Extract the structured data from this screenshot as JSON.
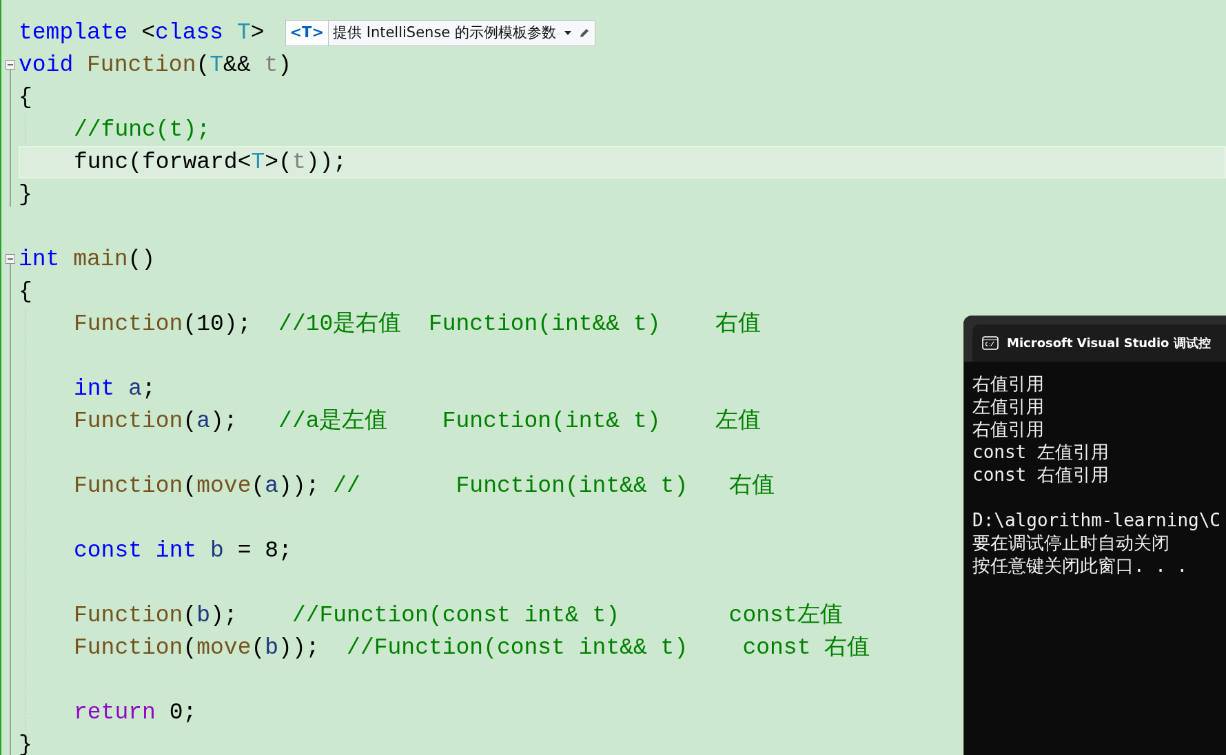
{
  "editor": {
    "template_line": {
      "tokens": [
        {
          "t": "template",
          "kind": "kw"
        },
        {
          "t": " <",
          "kind": "pl"
        },
        {
          "t": "class",
          "kind": "kw"
        },
        {
          "t": " T",
          "kind": "tp"
        },
        {
          "t": ">",
          "kind": "pl"
        }
      ],
      "hint": {
        "badge": "<T>",
        "text": "提供 IntelliSense 的示例模板参数"
      }
    },
    "functions": [
      {
        "collapsible": true,
        "signature": [
          {
            "t": "void",
            "kind": "kw"
          },
          {
            "t": " Function",
            "kind": "fn"
          },
          {
            "t": "(",
            "kind": "pl"
          },
          {
            "t": "T",
            "kind": "tp"
          },
          {
            "t": "&& ",
            "kind": "pl"
          },
          {
            "t": "t",
            "kind": "param"
          },
          {
            "t": ")",
            "kind": "pl"
          }
        ],
        "open_brace": "{",
        "close_brace": "}",
        "body": [
          {
            "lines": [
              {
                "current": false,
                "tokens": [
                  {
                    "t": "//func(t);",
                    "kind": "cm"
                  }
                ]
              },
              {
                "current": true,
                "tokens": [
                  {
                    "t": "func(forward<",
                    "kind": "pl"
                  },
                  {
                    "t": "T",
                    "kind": "tp"
                  },
                  {
                    "t": ">(",
                    "kind": "pl"
                  },
                  {
                    "t": "t",
                    "kind": "param"
                  },
                  {
                    "t": "));",
                    "kind": "pl"
                  }
                ]
              }
            ]
          }
        ]
      },
      {
        "collapsible": true,
        "signature": [
          {
            "t": "int",
            "kind": "kw"
          },
          {
            "t": " main",
            "kind": "fn"
          },
          {
            "t": "()",
            "kind": "pl"
          }
        ],
        "open_brace": "{",
        "close_brace": "}",
        "body": [
          {
            "lines": [
              {
                "current": false,
                "tokens": [
                  {
                    "t": "Function",
                    "kind": "fn"
                  },
                  {
                    "t": "(10);",
                    "kind": "pl"
                  },
                  {
                    "t": "  //10是右值  Function(int&& t)    右值",
                    "kind": "cm"
                  }
                ]
              }
            ]
          },
          {
            "lines": [
              {
                "current": false,
                "tokens": [
                  {
                    "t": "int",
                    "kind": "kw"
                  },
                  {
                    "t": " a",
                    "kind": "var"
                  },
                  {
                    "t": ";",
                    "kind": "pl"
                  }
                ]
              },
              {
                "current": false,
                "tokens": [
                  {
                    "t": "Function",
                    "kind": "fn"
                  },
                  {
                    "t": "(",
                    "kind": "pl"
                  },
                  {
                    "t": "a",
                    "kind": "var"
                  },
                  {
                    "t": ");",
                    "kind": "pl"
                  },
                  {
                    "t": "   //a是左值    Function(int& t)    左值",
                    "kind": "cm"
                  }
                ]
              }
            ]
          },
          {
            "lines": [
              {
                "current": false,
                "tokens": [
                  {
                    "t": "Function",
                    "kind": "fn"
                  },
                  {
                    "t": "(",
                    "kind": "pl"
                  },
                  {
                    "t": "move",
                    "kind": "fn"
                  },
                  {
                    "t": "(",
                    "kind": "pl"
                  },
                  {
                    "t": "a",
                    "kind": "var"
                  },
                  {
                    "t": "));",
                    "kind": "pl"
                  },
                  {
                    "t": " //       Function(int&& t)   右值",
                    "kind": "cm"
                  }
                ]
              }
            ]
          },
          {
            "lines": [
              {
                "current": false,
                "tokens": [
                  {
                    "t": "const",
                    "kind": "kw"
                  },
                  {
                    "t": " int",
                    "kind": "kw"
                  },
                  {
                    "t": " b",
                    "kind": "var"
                  },
                  {
                    "t": " = 8;",
                    "kind": "pl"
                  }
                ]
              }
            ]
          },
          {
            "lines": [
              {
                "current": false,
                "tokens": [
                  {
                    "t": "Function",
                    "kind": "fn"
                  },
                  {
                    "t": "(",
                    "kind": "pl"
                  },
                  {
                    "t": "b",
                    "kind": "var"
                  },
                  {
                    "t": ");",
                    "kind": "pl"
                  },
                  {
                    "t": "    //Function(const int& t)        const左值",
                    "kind": "cm"
                  }
                ]
              },
              {
                "current": false,
                "tokens": [
                  {
                    "t": "Function",
                    "kind": "fn"
                  },
                  {
                    "t": "(",
                    "kind": "pl"
                  },
                  {
                    "t": "move",
                    "kind": "fn"
                  },
                  {
                    "t": "(",
                    "kind": "pl"
                  },
                  {
                    "t": "b",
                    "kind": "var"
                  },
                  {
                    "t": "));",
                    "kind": "pl"
                  },
                  {
                    "t": "  //Function(const int&& t)    const 右值",
                    "kind": "cm"
                  }
                ]
              }
            ]
          },
          {
            "lines": [
              {
                "current": false,
                "tokens": [
                  {
                    "t": "return",
                    "kind": "ret"
                  },
                  {
                    "t": " 0;",
                    "kind": "pl"
                  }
                ]
              }
            ]
          }
        ]
      }
    ]
  },
  "console": {
    "title": "Microsoft Visual Studio 调试控",
    "blocks": [
      {
        "lines": [
          "右值引用",
          "左值引用",
          "右值引用",
          "const 左值引用",
          "const 右值引用"
        ]
      },
      {
        "lines": [
          "D:\\algorithm-learning\\C",
          "要在调试停止时自动关闭",
          "按任意键关闭此窗口. . ."
        ]
      }
    ]
  }
}
